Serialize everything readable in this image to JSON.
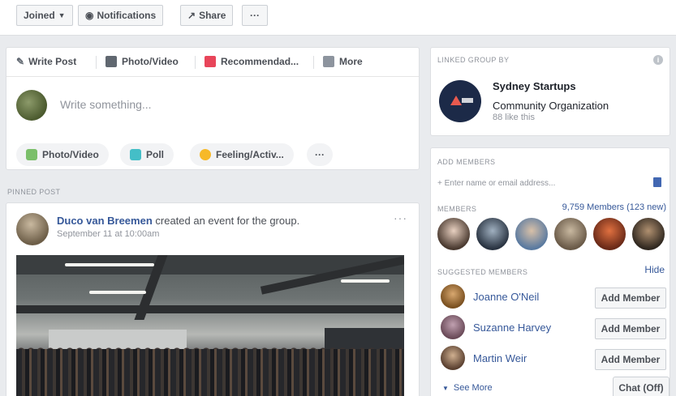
{
  "toolbar": {
    "joined_label": "Joined",
    "notifications_label": "Notifications",
    "share_label": "Share",
    "more_label": "···"
  },
  "composer": {
    "tabs": [
      {
        "label": "Write Post",
        "icon": "pencil-icon"
      },
      {
        "label": "Photo/Video",
        "icon": "photo-icon"
      },
      {
        "label": "Recommendad...",
        "icon": "recommend-icon"
      },
      {
        "label": "More",
        "icon": "more-grid-icon"
      }
    ],
    "placeholder": "Write something...",
    "actions": [
      {
        "label": "Photo/Video",
        "icon": "photo-icon"
      },
      {
        "label": "Poll",
        "icon": "poll-icon"
      },
      {
        "label": "Feeling/Activ...",
        "icon": "feeling-icon"
      },
      {
        "label": "···",
        "icon": "more-icon"
      }
    ]
  },
  "pinned": {
    "section_label": "PINNED POST",
    "author": "Duco van Breemen",
    "action_text": "created an event for the group.",
    "date": "September 11 at 10:00am",
    "menu_label": "···"
  },
  "linked_group": {
    "section_label": "LINKED GROUP BY",
    "info_label": "i",
    "name": "Sydney Startups",
    "type": "Community Organization",
    "likes": "88 like this"
  },
  "members_panel": {
    "add_label": "ADD MEMBERS",
    "add_placeholder": "+ Enter name or email address...",
    "members_label": "MEMBERS",
    "members_count": "9,759 Members (123 new)",
    "suggested_label": "SUGGESTED MEMBERS",
    "hide_label": "Hide",
    "suggested": [
      {
        "name": "Joanne O'Neil",
        "button": "Add Member"
      },
      {
        "name": "Suzanne Harvey",
        "button": "Add Member"
      },
      {
        "name": "Martin Weir",
        "button": "Add Member"
      }
    ],
    "see_more": "See More",
    "chat_label": "Chat (Off)"
  },
  "colors": {
    "link": "#365899",
    "background": "#e9ebee",
    "brand": "#4267b2"
  }
}
